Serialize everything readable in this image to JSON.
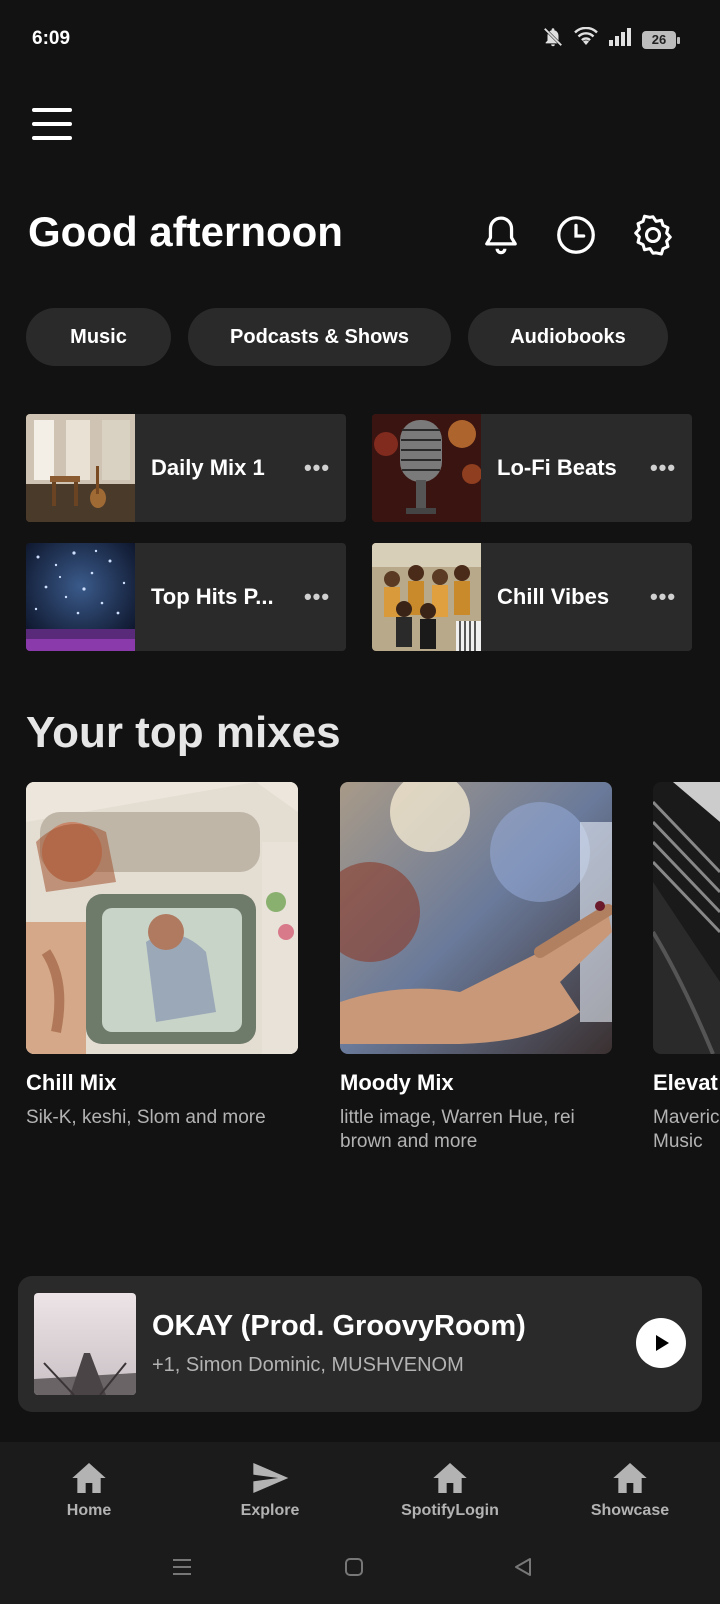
{
  "status_bar": {
    "time": "6:09",
    "battery": "26",
    "icons": [
      "bell-off-icon",
      "wifi-icon",
      "signal-icon",
      "battery-icon"
    ]
  },
  "header": {
    "greeting": "Good afternoon",
    "icons": [
      "menu-icon",
      "bell-icon",
      "clock-icon",
      "gear-icon"
    ]
  },
  "filters": [
    {
      "label": "Music"
    },
    {
      "label": "Podcasts & Shows"
    },
    {
      "label": "Audiobooks"
    }
  ],
  "quick_tiles": [
    {
      "label": "Daily Mix 1",
      "more": "•••"
    },
    {
      "label": "Lo-Fi Beats",
      "more": "•••"
    },
    {
      "label": "Top Hits P...",
      "more": "•••"
    },
    {
      "label": "Chill Vibes",
      "more": "•••"
    }
  ],
  "top_mixes": {
    "title": "Your top mixes",
    "items": [
      {
        "title": "Chill Mix",
        "subtitle": "Sik-K, keshi, Slom and more"
      },
      {
        "title": "Moody Mix",
        "subtitle": "little image, Warren Hue, rei brown and more"
      },
      {
        "title": "Elevat",
        "subtitle": "Maveric Music"
      }
    ]
  },
  "now_playing": {
    "title": "OKAY (Prod. GroovyRoom)",
    "artist": "+1, Simon Dominic, MUSHVENOM",
    "icon": "play-icon"
  },
  "bottom_nav": [
    {
      "label": "Home",
      "icon": "home-icon"
    },
    {
      "label": "Explore",
      "icon": "send-icon"
    },
    {
      "label": "SpotifyLogin",
      "icon": "home-icon"
    },
    {
      "label": "Showcase",
      "icon": "home-icon"
    }
  ],
  "colors": {
    "background": "#121212",
    "surface": "#2a2a2a",
    "text_secondary": "#b3b3b3"
  }
}
